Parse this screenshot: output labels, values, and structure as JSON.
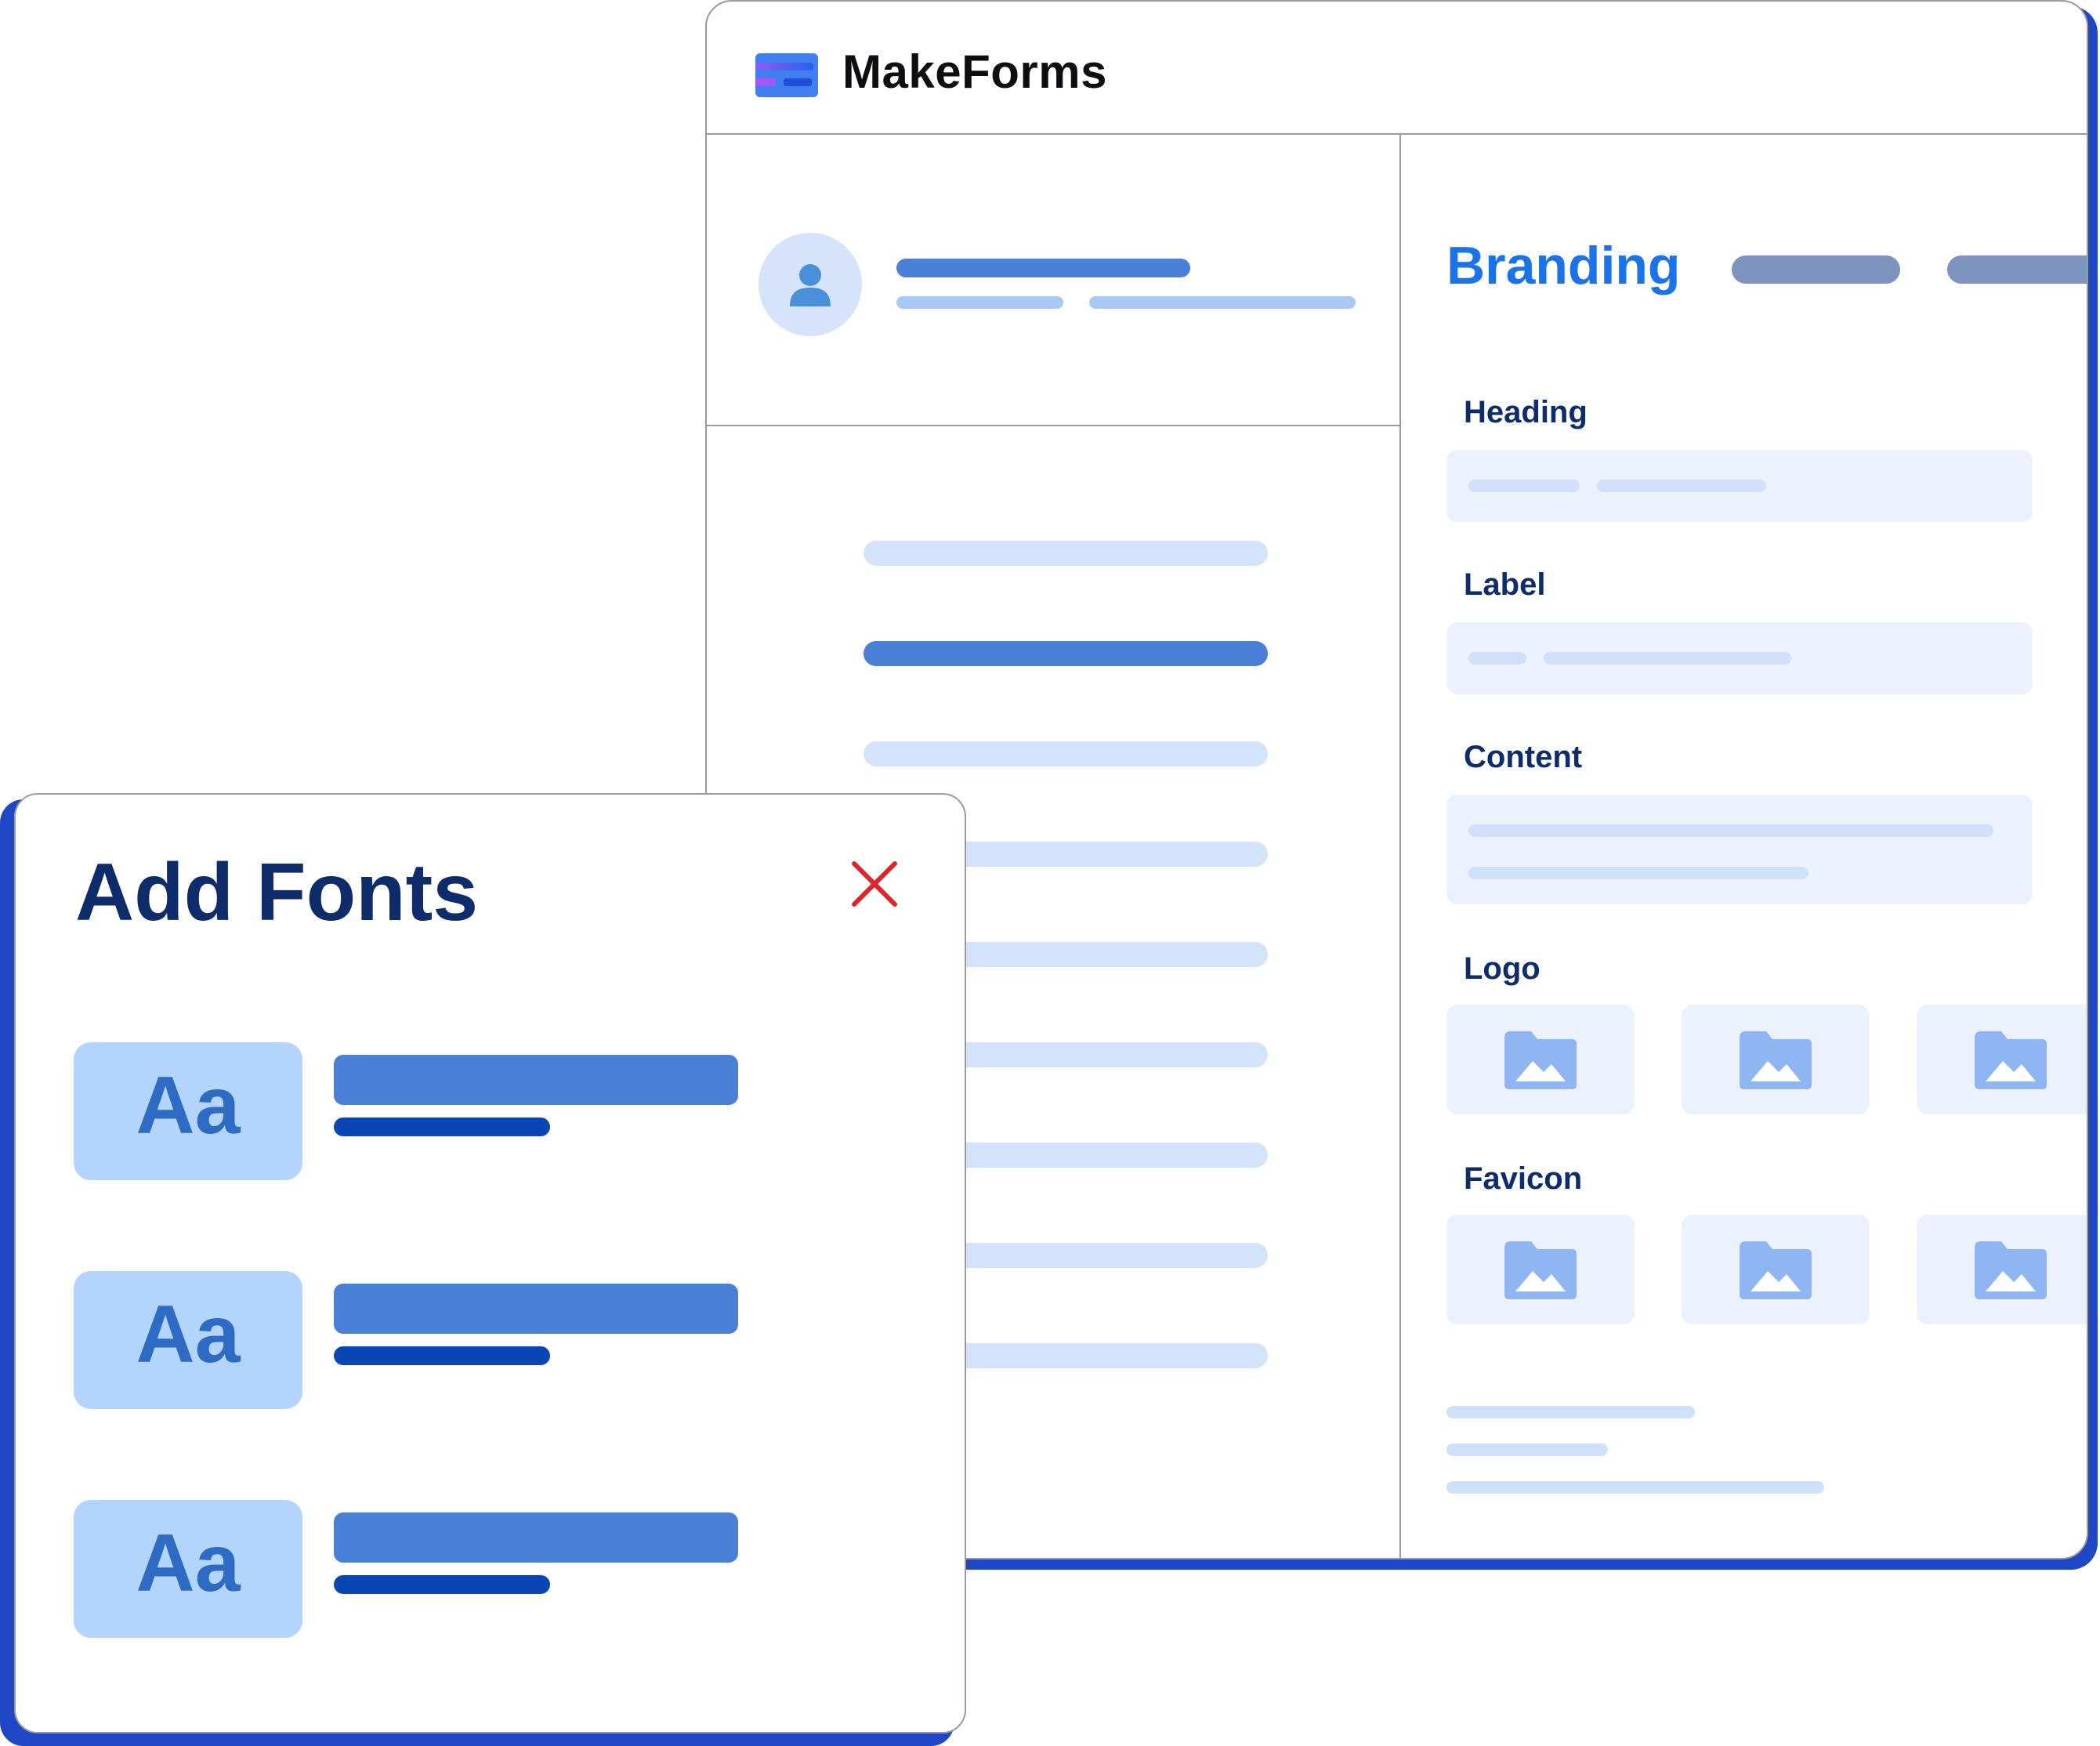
{
  "app": {
    "title": "MakeForms"
  },
  "branding": {
    "title": "Branding",
    "fields": {
      "heading": "Heading",
      "label": "Label",
      "content": "Content",
      "logo": "Logo",
      "favicon": "Favicon"
    }
  },
  "add_fonts": {
    "title": "Add Fonts",
    "samples": [
      "Aa",
      "Aa",
      "Aa"
    ]
  },
  "colors": {
    "brand_blue": "#1a73e8",
    "dark_navy": "#0d2c69",
    "shadow_blue": "#1f46c4",
    "placeholder_bar": "#4a7fd6",
    "light_bar": "#d3e3fb",
    "close_red": "#e0242b"
  },
  "icons": [
    "app-logo-icon",
    "user-icon",
    "image-folder-icon",
    "close-icon"
  ]
}
